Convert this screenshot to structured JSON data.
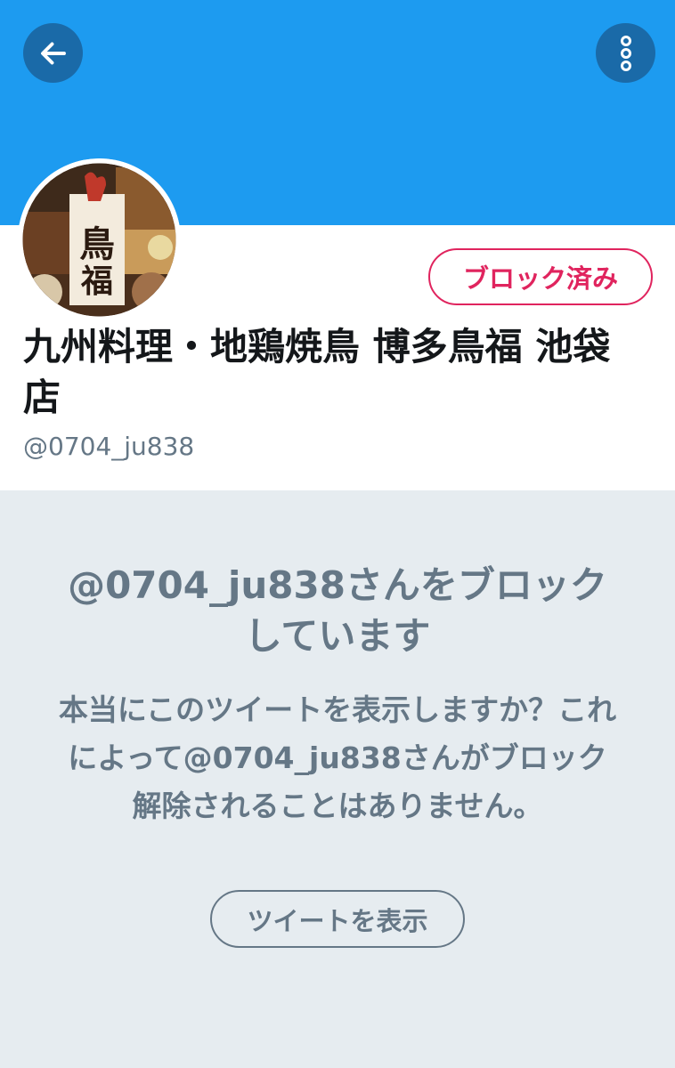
{
  "header": {
    "back_icon": "arrow-left-icon",
    "more_icon": "more-vertical-icon",
    "banner_color": "#1d9bf0"
  },
  "profile": {
    "avatar_text_line1": "鳥",
    "avatar_text_line2": "福",
    "block_status_label": "ブロック済み",
    "display_name": "九州料理・地鶏焼鳥 博多鳥福 池袋店",
    "handle": "@0704_ju838"
  },
  "blocked_notice": {
    "title": "@0704_ju838さんをブロックしています",
    "body": "本当にこのツイートを表示しますか？これによって@0704_ju838さんがブロック解除されることはありません。",
    "show_button_label": "ツイートを表示"
  },
  "colors": {
    "accent_block": "#e0245e",
    "muted_text": "#657786",
    "background": "#e6ecf0"
  }
}
